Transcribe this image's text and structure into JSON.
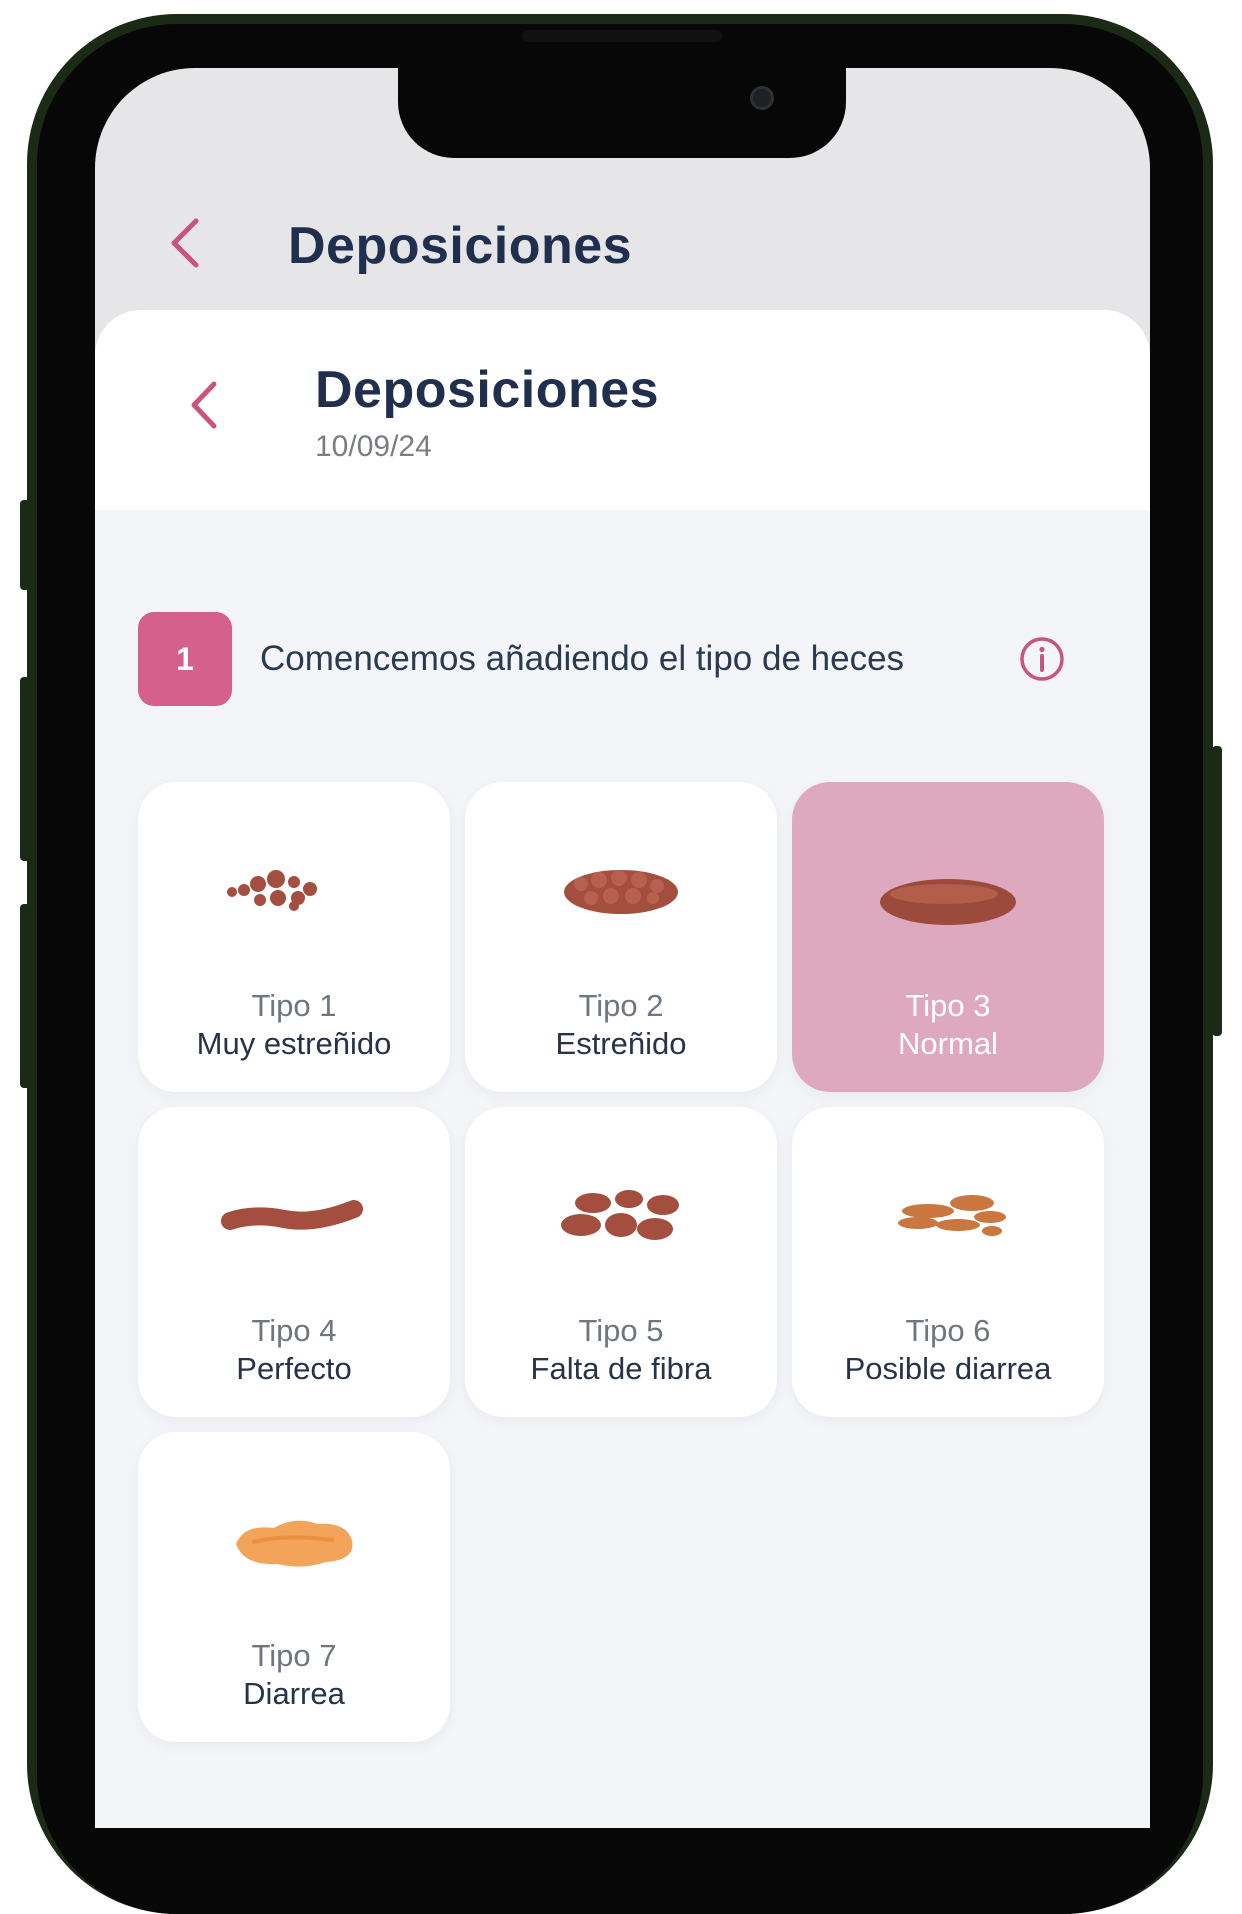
{
  "app_bar": {
    "back_icon": "chevron-left-icon",
    "title": "Deposiciones"
  },
  "sheet": {
    "back_icon": "chevron-left-icon",
    "title": "Deposiciones",
    "date": "10/09/24"
  },
  "step": {
    "number": "1",
    "text": "Comencemos añadiendo el tipo de heces",
    "info_icon": "info-circle-icon"
  },
  "colors": {
    "accent": "#d5608a",
    "selected_card": "#dea9bf",
    "title": "#1f2f4d"
  },
  "stool_types": [
    {
      "tipo": "Tipo 1",
      "label": "Muy estreñido",
      "icon": "pellets-icon",
      "selected": false
    },
    {
      "tipo": "Tipo 2",
      "label": "Estreñido",
      "icon": "lumpy-sausage-icon",
      "selected": false
    },
    {
      "tipo": "Tipo 3",
      "label": "Normal",
      "icon": "cracked-sausage-icon",
      "selected": true
    },
    {
      "tipo": "Tipo 4",
      "label": "Perfecto",
      "icon": "smooth-snake-icon",
      "selected": false
    },
    {
      "tipo": "Tipo 5",
      "label": "Falta de fibra",
      "icon": "soft-blobs-icon",
      "selected": false
    },
    {
      "tipo": "Tipo 6",
      "label": "Posible diarrea",
      "icon": "fluffy-pieces-icon",
      "selected": false
    },
    {
      "tipo": "Tipo 7",
      "label": "Diarrea",
      "icon": "watery-icon",
      "selected": false
    }
  ]
}
